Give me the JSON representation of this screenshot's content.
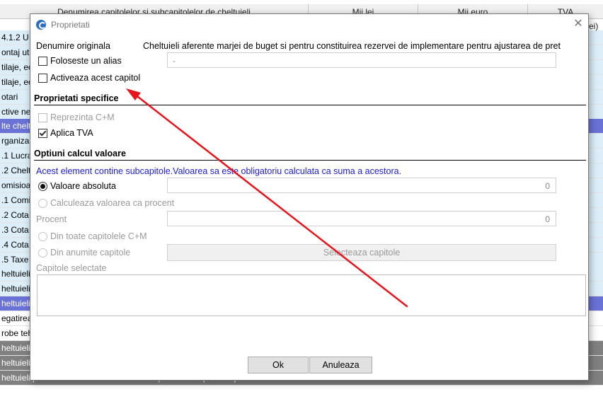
{
  "background_table": {
    "headers": [
      "Denumirea capitolelor si subcapitolelor de cheltuieli",
      "Mii lei",
      "Mii euro",
      "TVA"
    ],
    "rows": [
      {
        "text": "4.1.2 U",
        "style": "blue"
      },
      {
        "text": "ontaj ut",
        "style": "blue"
      },
      {
        "text": "tilaje, ec",
        "style": "blue"
      },
      {
        "text": "tilaje, ec",
        "style": "blue"
      },
      {
        "text": "otari",
        "style": "blue"
      },
      {
        "text": "ctive nec",
        "style": "blue"
      },
      {
        "text": "lte chelt",
        "style": "purple"
      },
      {
        "text": "rganizar",
        "style": "blue"
      },
      {
        "text": ".1 Lucra",
        "style": "blue"
      },
      {
        "text": ".2 Chelt",
        "style": "blue"
      },
      {
        "text": "omisioa",
        "style": "blue"
      },
      {
        "text": ".1 Comi",
        "style": "blue"
      },
      {
        "text": ".2 Cota",
        "style": "blue"
      },
      {
        "text": ".3 Cota",
        "style": "blue"
      },
      {
        "text": ".4 Cota",
        "style": "blue"
      },
      {
        "text": ".5 Taxe",
        "style": "blue"
      },
      {
        "text": "heltuieli",
        "style": "blue"
      },
      {
        "text": "heltuieli",
        "style": "blue"
      },
      {
        "text": "heltuieli",
        "style": "purple"
      },
      {
        "text": "egatirea",
        "style": "white"
      },
      {
        "text": "robe teh",
        "style": "white"
      },
      {
        "text": "heltuieli",
        "style": "gray"
      },
      {
        "text": "heltuieli",
        "style": "gray"
      },
      {
        "text": "heltuieli pentru constituirea rezervei de implementare pentru ajustarea ...",
        "style": "gray"
      }
    ],
    "right_cell": "ei)"
  },
  "dialog": {
    "title": "Proprietati",
    "close_glyph": "✕",
    "original_name_label": "Denumire originala",
    "original_name_value": "Cheltuieli aferente marjei de buget si pentru constituirea rezervei de implementare pentru ajustarea de pret",
    "use_alias_label": "Foloseste un alias",
    "alias_value": "-",
    "activate_label": "Activeaza acest capitol",
    "specific_section": "Proprietati specifice",
    "represents_label": "Reprezinta C+M",
    "apply_vat_label": "Aplica TVA",
    "calc_section": "Optiuni calcul valoare",
    "info_text": "Acest element contine subcapitole.Valoarea sa este obligatoriu calculata ca suma a acestora.",
    "absolute_value_label": "Valoare absoluta",
    "absolute_value": "0",
    "calc_percent_label": "Calculeaza valoarea ca procent",
    "percent_label": "Procent",
    "percent_value": "0",
    "all_chapters_label": "Din toate capitolele C+M",
    "some_chapters_label": "Din anumite capitole",
    "select_chapters_button": "Selecteaza capitole",
    "selected_chapters_label": "Capitole selectate",
    "ok_button": "Ok",
    "cancel_button": "Anuleaza"
  },
  "colors": {
    "row_blue": "#ddeef8",
    "row_purple": "#6b72d6",
    "row_gray": "#808080",
    "info_blue": "#1a1ad6",
    "annotation_arrow": "#e8141b"
  }
}
